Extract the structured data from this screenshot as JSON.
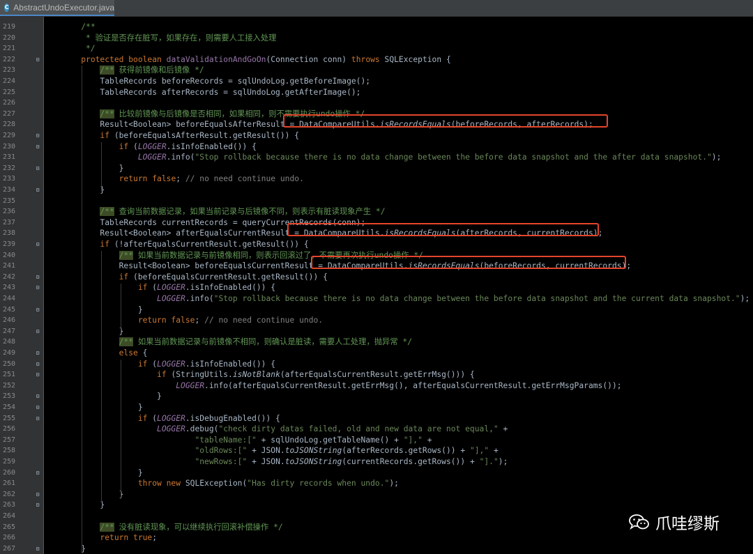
{
  "tab": {
    "filename": "AbstractUndoExecutor.java"
  },
  "watermark": {
    "text": "爪哇缪斯",
    "icon": "wechat-icon"
  },
  "lines": [
    {
      "n": "219",
      "fold": "",
      "segs": [
        [
          "    ",
          ""
        ],
        [
          "/**",
          "jd"
        ]
      ]
    },
    {
      "n": "220",
      "fold": "",
      "segs": [
        [
          "     * 验证是否存在脏写，如果存在，则需要人工接入处理",
          "jd"
        ]
      ]
    },
    {
      "n": "221",
      "fold": "",
      "segs": [
        [
          "     */",
          "jd"
        ]
      ]
    },
    {
      "n": "222",
      "fold": "⊟",
      "segs": [
        [
          "    ",
          ""
        ],
        [
          "protected boolean ",
          "kw"
        ],
        [
          "dataValidationAndGoOn",
          "md"
        ],
        [
          "(Connection conn) ",
          ""
        ],
        [
          "throws ",
          "kw"
        ],
        [
          "SQLException {",
          ""
        ]
      ]
    },
    {
      "n": "223",
      "fold": "",
      "segs": [
        [
          "        ",
          ""
        ],
        [
          "/**",
          "jdtag"
        ],
        [
          " 获得前镜像和后镜像 */",
          "jd"
        ]
      ]
    },
    {
      "n": "224",
      "fold": "",
      "segs": [
        [
          "        TableRecords beforeRecords = sqlUndoLog.getBeforeImage();",
          ""
        ]
      ]
    },
    {
      "n": "225",
      "fold": "",
      "segs": [
        [
          "        TableRecords afterRecords = sqlUndoLog.getAfterImage();",
          ""
        ]
      ]
    },
    {
      "n": "226",
      "fold": "",
      "segs": []
    },
    {
      "n": "227",
      "fold": "",
      "segs": [
        [
          "        ",
          ""
        ],
        [
          "/**",
          "jdtag"
        ],
        [
          " 比较前镜像与后镜像是否相同，如果相同，则不需要执行undo操作 */",
          "jd"
        ]
      ]
    },
    {
      "n": "228",
      "fold": "",
      "segs": [
        [
          "        Result<Boolean> beforeEqualsAfterResult = ",
          ""
        ],
        [
          "DataCompareUtils.",
          ""
        ],
        [
          "isRecordsEquals",
          "sm"
        ],
        [
          "(beforeRecords, afterRecords);",
          ""
        ]
      ]
    },
    {
      "n": "229",
      "fold": "⊟",
      "segs": [
        [
          "        ",
          ""
        ],
        [
          "if ",
          "kw"
        ],
        [
          "(beforeEqualsAfterResult.getResult()) {",
          ""
        ]
      ]
    },
    {
      "n": "230",
      "fold": "⊟",
      "segs": [
        [
          "            ",
          ""
        ],
        [
          "if ",
          "kw"
        ],
        [
          "(",
          ""
        ],
        [
          "LOGGER",
          "fi"
        ],
        [
          ".isInfoEnabled()) {",
          ""
        ]
      ]
    },
    {
      "n": "231",
      "fold": "",
      "segs": [
        [
          "                ",
          ""
        ],
        [
          "LOGGER",
          "fi"
        ],
        [
          ".info(",
          ""
        ],
        [
          "\"Stop rollback because there is no data change between the before data snapshot and the after data snapshot.\"",
          "st"
        ],
        [
          ");",
          ""
        ]
      ]
    },
    {
      "n": "232",
      "fold": "⊟",
      "segs": [
        [
          "            }",
          ""
        ]
      ]
    },
    {
      "n": "233",
      "fold": "",
      "segs": [
        [
          "            ",
          ""
        ],
        [
          "return false",
          "kw"
        ],
        [
          "; ",
          ""
        ],
        [
          "// no need continue undo.",
          "cm"
        ]
      ]
    },
    {
      "n": "234",
      "fold": "⊟",
      "segs": [
        [
          "        }",
          ""
        ]
      ]
    },
    {
      "n": "235",
      "fold": "",
      "segs": []
    },
    {
      "n": "236",
      "fold": "",
      "segs": [
        [
          "        ",
          ""
        ],
        [
          "/**",
          "jdtag"
        ],
        [
          " 查询当前数据记录，如果当前记录与后镜像不同，则表示有脏读现象产生 */",
          "jd"
        ]
      ]
    },
    {
      "n": "237",
      "fold": "",
      "segs": [
        [
          "        TableRecords currentRecords = queryCurrentRecords(conn);",
          ""
        ]
      ]
    },
    {
      "n": "238",
      "fold": "",
      "segs": [
        [
          "        Result<Boolean> afterEqualsCurrentResult = ",
          ""
        ],
        [
          "DataCompareUtils.",
          ""
        ],
        [
          "isRecordsEquals",
          "sm"
        ],
        [
          "(afterRecords, currentRecords);",
          ""
        ]
      ]
    },
    {
      "n": "239",
      "fold": "⊟",
      "segs": [
        [
          "        ",
          ""
        ],
        [
          "if ",
          "kw"
        ],
        [
          "(!afterEqualsCurrentResult.getResult()) {",
          ""
        ]
      ]
    },
    {
      "n": "240",
      "fold": "",
      "segs": [
        [
          "            ",
          ""
        ],
        [
          "/**",
          "jdtag"
        ],
        [
          " 如果当前数据记录与前镜像相同，则表示回滚过了，不需要再次执行undo操作 */",
          "jd"
        ]
      ]
    },
    {
      "n": "241",
      "fold": "",
      "segs": [
        [
          "            Result<Boolean> beforeEqualsCurrentResult = ",
          ""
        ],
        [
          "DataCompareUtils.",
          ""
        ],
        [
          "isRecordsEquals",
          "sm"
        ],
        [
          "(beforeRecords, currentRecords);",
          ""
        ]
      ]
    },
    {
      "n": "242",
      "fold": "⊟",
      "segs": [
        [
          "            ",
          ""
        ],
        [
          "if ",
          "kw"
        ],
        [
          "(beforeEqualsCurrentResult.getResult()) {",
          ""
        ]
      ]
    },
    {
      "n": "243",
      "fold": "⊟",
      "segs": [
        [
          "                ",
          ""
        ],
        [
          "if ",
          "kw"
        ],
        [
          "(",
          ""
        ],
        [
          "LOGGER",
          "fi"
        ],
        [
          ".isInfoEnabled()) {",
          ""
        ]
      ]
    },
    {
      "n": "244",
      "fold": "",
      "segs": [
        [
          "                    ",
          ""
        ],
        [
          "LOGGER",
          "fi"
        ],
        [
          ".info(",
          ""
        ],
        [
          "\"Stop rollback because there is no data change between the before data snapshot and the current data snapshot.\"",
          "st"
        ],
        [
          ");",
          ""
        ]
      ]
    },
    {
      "n": "245",
      "fold": "⊟",
      "segs": [
        [
          "                }",
          ""
        ]
      ]
    },
    {
      "n": "246",
      "fold": "",
      "segs": [
        [
          "                ",
          ""
        ],
        [
          "return false",
          "kw"
        ],
        [
          "; ",
          ""
        ],
        [
          "// no need continue undo.",
          "cm"
        ]
      ]
    },
    {
      "n": "247",
      "fold": "⊟",
      "segs": [
        [
          "            }",
          ""
        ]
      ]
    },
    {
      "n": "248",
      "fold": "",
      "segs": [
        [
          "            ",
          ""
        ],
        [
          "/**",
          "jdtag"
        ],
        [
          " 如果当前数据记录与前镜像不相同，则确认是脏读，需要人工处理，抛异常 */",
          "jd"
        ]
      ]
    },
    {
      "n": "249",
      "fold": "⊟",
      "segs": [
        [
          "            ",
          ""
        ],
        [
          "else ",
          "kw"
        ],
        [
          "{",
          ""
        ]
      ]
    },
    {
      "n": "250",
      "fold": "⊟",
      "segs": [
        [
          "                ",
          ""
        ],
        [
          "if ",
          "kw"
        ],
        [
          "(",
          ""
        ],
        [
          "LOGGER",
          "fi"
        ],
        [
          ".isInfoEnabled()) {",
          ""
        ]
      ]
    },
    {
      "n": "251",
      "fold": "⊟",
      "segs": [
        [
          "                    ",
          ""
        ],
        [
          "if ",
          "kw"
        ],
        [
          "(StringUtils.",
          ""
        ],
        [
          "isNotBlank",
          "sm"
        ],
        [
          "(afterEqualsCurrentResult.getErrMsg())) {",
          ""
        ]
      ]
    },
    {
      "n": "252",
      "fold": "",
      "segs": [
        [
          "                        ",
          ""
        ],
        [
          "LOGGER",
          "fi"
        ],
        [
          ".info(afterEqualsCurrentResult.getErrMsg(), afterEqualsCurrentResult.getErrMsgParams());",
          ""
        ]
      ]
    },
    {
      "n": "253",
      "fold": "⊟",
      "segs": [
        [
          "                    }",
          ""
        ]
      ]
    },
    {
      "n": "254",
      "fold": "⊟",
      "segs": [
        [
          "                }",
          ""
        ]
      ]
    },
    {
      "n": "255",
      "fold": "⊟",
      "segs": [
        [
          "                ",
          ""
        ],
        [
          "if ",
          "kw"
        ],
        [
          "(",
          ""
        ],
        [
          "LOGGER",
          "fi"
        ],
        [
          ".isDebugEnabled()) {",
          ""
        ]
      ]
    },
    {
      "n": "256",
      "fold": "",
      "segs": [
        [
          "                    ",
          ""
        ],
        [
          "LOGGER",
          "fi"
        ],
        [
          ".debug(",
          ""
        ],
        [
          "\"check dirty datas failed, old and new data are not equal,\"",
          "st"
        ],
        [
          " +",
          ""
        ]
      ]
    },
    {
      "n": "257",
      "fold": "",
      "segs": [
        [
          "                            ",
          ""
        ],
        [
          "\"tableName:[\"",
          "st"
        ],
        [
          " + sqlUndoLog.getTableName() + ",
          ""
        ],
        [
          "\"],\"",
          "st"
        ],
        [
          " +",
          ""
        ]
      ]
    },
    {
      "n": "258",
      "fold": "",
      "segs": [
        [
          "                            ",
          ""
        ],
        [
          "\"oldRows:[\"",
          "st"
        ],
        [
          " + JSON.",
          ""
        ],
        [
          "toJSONString",
          "sm"
        ],
        [
          "(afterRecords.getRows()) + ",
          ""
        ],
        [
          "\"],\"",
          "st"
        ],
        [
          " +",
          ""
        ]
      ]
    },
    {
      "n": "259",
      "fold": "",
      "segs": [
        [
          "                            ",
          ""
        ],
        [
          "\"newRows:[\"",
          "st"
        ],
        [
          " + JSON.",
          ""
        ],
        [
          "toJSONString",
          "sm"
        ],
        [
          "(currentRecords.getRows()) + ",
          ""
        ],
        [
          "\"].\"",
          "st"
        ],
        [
          ");",
          ""
        ]
      ]
    },
    {
      "n": "260",
      "fold": "⊟",
      "segs": [
        [
          "                }",
          ""
        ]
      ]
    },
    {
      "n": "261",
      "fold": "",
      "segs": [
        [
          "                ",
          ""
        ],
        [
          "throw new ",
          "kw"
        ],
        [
          "SQLException(",
          ""
        ],
        [
          "\"Has dirty records when undo.\"",
          "st"
        ],
        [
          ");",
          ""
        ]
      ]
    },
    {
      "n": "262",
      "fold": "⊟",
      "segs": [
        [
          "            }",
          ""
        ]
      ]
    },
    {
      "n": "263",
      "fold": "⊟",
      "segs": [
        [
          "        }",
          ""
        ]
      ]
    },
    {
      "n": "264",
      "fold": "",
      "segs": []
    },
    {
      "n": "265",
      "fold": "",
      "segs": [
        [
          "        ",
          ""
        ],
        [
          "/**",
          "jdtag"
        ],
        [
          " 没有脏读现象，可以继续执行回滚补偿操作 */",
          "jd"
        ]
      ]
    },
    {
      "n": "266",
      "fold": "",
      "segs": [
        [
          "        ",
          ""
        ],
        [
          "return true",
          "kw"
        ],
        [
          ";",
          ""
        ]
      ]
    },
    {
      "n": "267",
      "fold": "⊟",
      "segs": [
        [
          "    }",
          ""
        ]
      ]
    }
  ]
}
